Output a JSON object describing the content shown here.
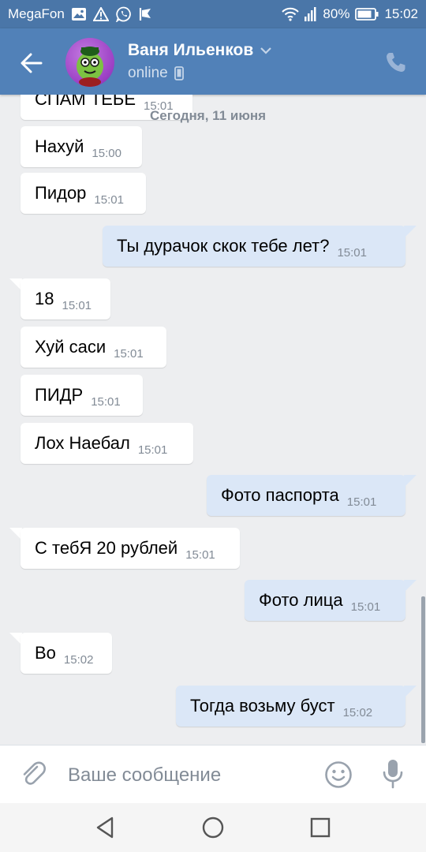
{
  "status_bar": {
    "carrier": "MegaFon",
    "battery": "80%",
    "time": "15:02"
  },
  "header": {
    "contact_name": "Ваня Ильенков",
    "presence": "online"
  },
  "date_separator": "Сегодня, 11 июня",
  "messages": [
    {
      "dir": "in",
      "text": "СПАМ ТЕБЕ",
      "time": "15:01"
    },
    {
      "dir": "in",
      "text": "Нахуй",
      "time": "15:00"
    },
    {
      "dir": "in",
      "text": "Пидор",
      "time": "15:01"
    },
    {
      "dir": "out",
      "text": "Ты дурачок скок тебе лет?",
      "time": "15:01"
    },
    {
      "dir": "in",
      "text": "18",
      "time": "15:01"
    },
    {
      "dir": "in",
      "text": "Хуй саси",
      "time": "15:01"
    },
    {
      "dir": "in",
      "text": "ПИДР",
      "time": "15:01"
    },
    {
      "dir": "in",
      "text": "Лох Наебал",
      "time": "15:01"
    },
    {
      "dir": "out",
      "text": "Фото паспорта",
      "time": "15:01"
    },
    {
      "dir": "in",
      "text": "С тебЯ 20 рублей",
      "time": "15:01"
    },
    {
      "dir": "out",
      "text": "Фото лица",
      "time": "15:01"
    },
    {
      "dir": "in",
      "text": "Во",
      "time": "15:02"
    },
    {
      "dir": "out",
      "text": "Тогда возьму буст",
      "time": "15:02"
    }
  ],
  "composer": {
    "placeholder": "Ваше сообщение"
  },
  "icons": {
    "status_left": [
      "image-icon",
      "warning-icon",
      "whatsapp-icon",
      "delivery-icon"
    ],
    "status_right": [
      "wifi-icon",
      "signal-icon",
      "battery-icon"
    ],
    "header": [
      "back-arrow-icon",
      "chevron-down-icon",
      "mobile-icon",
      "phone-icon"
    ],
    "composer": [
      "paperclip-icon",
      "emoji-icon",
      "microphone-icon"
    ],
    "navbar": [
      "nav-back-icon",
      "nav-home-icon",
      "nav-recents-icon"
    ]
  },
  "colors": {
    "status_bar": "#4a76a8",
    "header": "#5181b8",
    "background": "#edeef0",
    "incoming_bubble": "#ffffff",
    "outgoing_bubble": "#dbe7f7"
  }
}
